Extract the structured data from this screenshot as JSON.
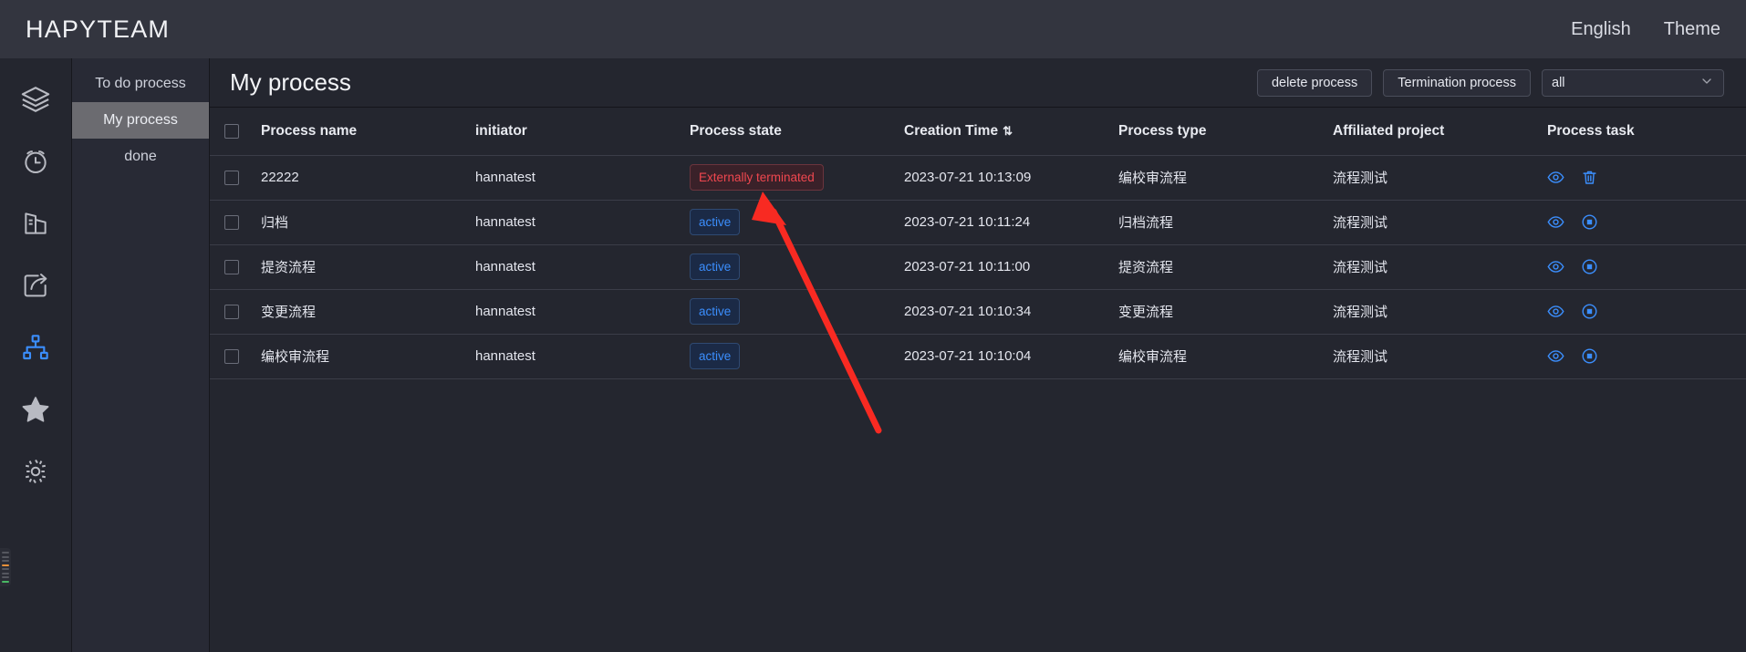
{
  "header": {
    "brand": "HAPYTEAM",
    "language_label": "English",
    "theme_label": "Theme"
  },
  "rail": {
    "items": [
      {
        "name": "layers-icon",
        "label": "layers"
      },
      {
        "name": "alarm-clock-icon",
        "label": "alarm clock"
      },
      {
        "name": "chart-building-icon",
        "label": "statistics"
      },
      {
        "name": "share-export-icon",
        "label": "share"
      },
      {
        "name": "sitemap-icon",
        "label": "process",
        "active": true
      },
      {
        "name": "star-icon",
        "label": "favorites"
      },
      {
        "name": "gear-icon",
        "label": "settings"
      }
    ],
    "active_color": "#3b8efd",
    "inactive_color": "#b8bac2"
  },
  "subnav": {
    "items": [
      {
        "label": "To do process",
        "active": false
      },
      {
        "label": "My process",
        "active": true
      },
      {
        "label": "done",
        "active": false
      }
    ]
  },
  "panel": {
    "title": "My process",
    "delete_button": "delete process",
    "termination_button": "Termination process",
    "filter_value": "all",
    "filter_options": [
      "all"
    ]
  },
  "table": {
    "headers": [
      "Process name",
      "initiator",
      "Process state",
      "Creation Time",
      "Process type",
      "Affiliated project",
      "Process task"
    ],
    "sort_column": "Creation Time",
    "sort_glyph": "⇅",
    "rows": [
      {
        "name": "22222",
        "initiator": "hannatest",
        "state": "Externally terminated",
        "state_kind": "terminated",
        "time": "2023-07-21 10:13:09",
        "type": "编校审流程",
        "project": "流程测试",
        "actions": [
          "view-icon",
          "delete-icon"
        ]
      },
      {
        "name": "归档",
        "initiator": "hannatest",
        "state": "active",
        "state_kind": "active",
        "time": "2023-07-21 10:11:24",
        "type": "归档流程",
        "project": "流程测试",
        "actions": [
          "view-icon",
          "stop-icon"
        ]
      },
      {
        "name": "提资流程",
        "initiator": "hannatest",
        "state": "active",
        "state_kind": "active",
        "time": "2023-07-21 10:11:00",
        "type": "提资流程",
        "project": "流程测试",
        "actions": [
          "view-icon",
          "stop-icon"
        ]
      },
      {
        "name": "变更流程",
        "initiator": "hannatest",
        "state": "active",
        "state_kind": "active",
        "time": "2023-07-21 10:10:34",
        "type": "变更流程",
        "project": "流程测试",
        "actions": [
          "view-icon",
          "stop-icon"
        ]
      },
      {
        "name": "编校审流程",
        "initiator": "hannatest",
        "state": "active",
        "state_kind": "active",
        "time": "2023-07-21 10:10:04",
        "type": "编校审流程",
        "project": "流程测试",
        "actions": [
          "view-icon",
          "stop-icon"
        ]
      }
    ]
  },
  "annotation": {
    "color": "#f82a22",
    "kind": "arrow",
    "points_to": "Externally terminated"
  },
  "colors": {
    "page_background": "#24262f",
    "topbar_background": "#33353f",
    "subnav_background": "#282a35",
    "active_accent": "#3b8efd",
    "terminated_accent": "#f0474f",
    "row_divider": "#3b3d48"
  }
}
